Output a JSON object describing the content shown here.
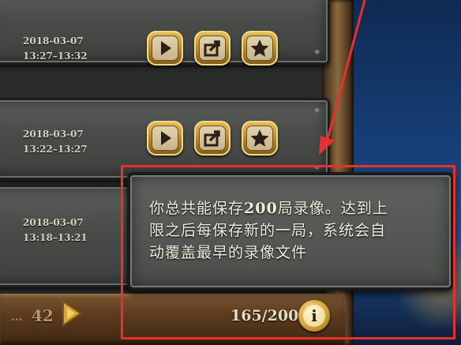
{
  "replays": [
    {
      "date": "2018-03-07",
      "time": "13:27–13:32"
    },
    {
      "date": "2018-03-07",
      "time": "13:22–13:27"
    },
    {
      "date": "2018-03-07",
      "time": "13:18–13:21"
    }
  ],
  "buttons": {
    "play_icon": "play-icon",
    "share_icon": "share-icon",
    "favorite_icon": "star-icon"
  },
  "pager": {
    "ellipsis": "...",
    "page": "42"
  },
  "storage": {
    "count": "165/200",
    "info_label": "i"
  },
  "tooltip": {
    "line1_pre": "你总共能保存",
    "line1_num": "200",
    "line1_post": "局录像。达到上",
    "line2": "限之后每保存新的一局，系统会自",
    "line3": "动覆盖最早的录像文件"
  },
  "colors": {
    "annotation": "#e8302f",
    "gold": "#d3a53a",
    "panel": "#4b4e4b"
  }
}
